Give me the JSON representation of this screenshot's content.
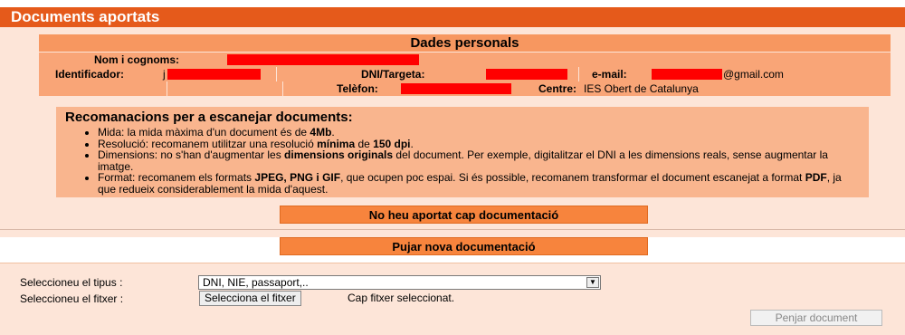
{
  "page": {
    "title": "Documents aportats"
  },
  "personal": {
    "section_title": "Dades personals",
    "name_label": "Nom i cognoms:",
    "id_label": "Identificador:",
    "id_value_prefix": "j",
    "dni_label": "DNI/Targeta:",
    "email_label": "e-mail:",
    "email_suffix": "@gmail.com",
    "phone_label": "Telèfon:",
    "centre_label": "Centre:",
    "centre_value": "IES Obert de Catalunya",
    "redaction_color": "#ff0000"
  },
  "recommendations": {
    "title": "Recomanacions per a escanejar documents:",
    "items": [
      {
        "pre": "Mida: la mida màxima d'un document és de ",
        "bold": "4Mb",
        "post": "."
      },
      {
        "pre": "Resolució: recomanem utilitzar una resolució ",
        "bold": "mínima",
        "mid": " de ",
        "bold2": "150 dpi",
        "post": "."
      },
      {
        "pre": "Dimensions: no s'han d'augmentar les ",
        "bold": "dimensions originals",
        "post": " del document. Per exemple, digitalitzar el DNI a les dimensions reals, sense augmentar la imatge."
      },
      {
        "pre": "Format: recomanem els formats ",
        "bold": "JPEG, PNG i GIF",
        "post": ", que ocupen poc espai. Si és possible, recomanem transformar el document escanejat a format ",
        "bold2": "PDF",
        "post2": ", ja que redueix considerablement la mida d'aquest."
      }
    ]
  },
  "status": {
    "no_docs": "No heu aportat cap documentació",
    "upload_new": "Pujar nova documentació"
  },
  "upload": {
    "type_label": "Seleccioneu el tipus :",
    "type_value": "DNI, NIE, passaport,..",
    "file_label": "Seleccioneu el fitxer :",
    "file_button": "Selecciona el fitxer",
    "file_status": "Cap fitxer seleccionat.",
    "submit": "Penjar document"
  },
  "colors": {
    "header": "#e55a1b",
    "accent": "#f7843d",
    "light": "#fde5d8"
  }
}
